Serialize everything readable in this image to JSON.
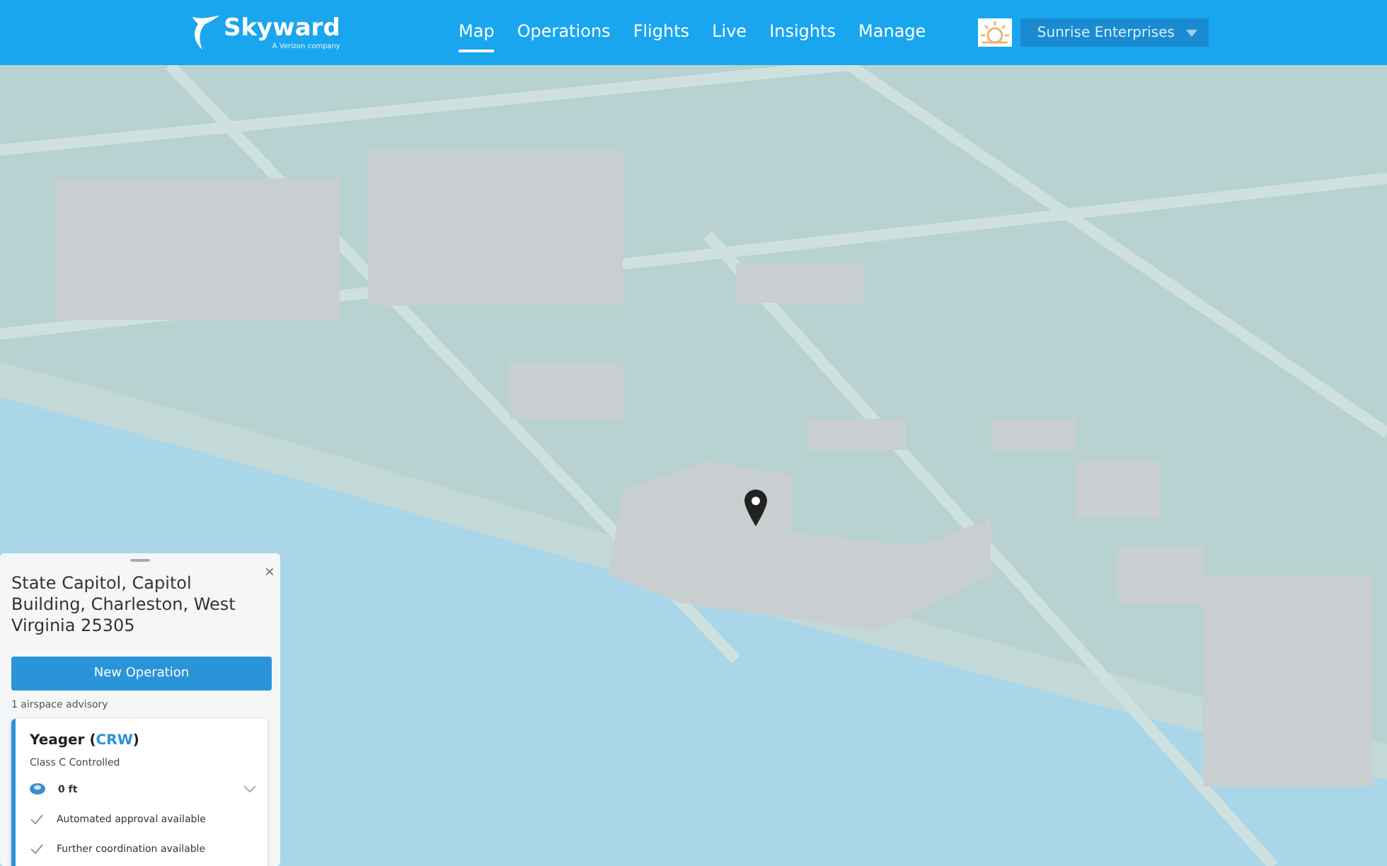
{
  "header": {
    "logo": {
      "name": "Skyward",
      "tagline": "A Verizon company"
    },
    "tabs": [
      {
        "label": "Map",
        "selected": true
      },
      {
        "label": "Operations",
        "selected": false
      },
      {
        "label": "Flights",
        "selected": false
      },
      {
        "label": "Live",
        "selected": false
      },
      {
        "label": "Insights",
        "selected": false
      },
      {
        "label": "Manage",
        "selected": false
      }
    ],
    "organization": {
      "name": "Sunrise Enterprises"
    }
  },
  "panel": {
    "address": "State Capitol, Capitol Building, Charleston, West Virginia 25305",
    "close": "×",
    "button": "New Operation",
    "advisory_count": "1 airspace advisory",
    "advisory": {
      "title_before": "Yeager (",
      "code": "CRW",
      "title_after": ")",
      "class": "Class C Controlled",
      "rows": [
        {
          "kind": "altitude",
          "text": "0 ft"
        },
        {
          "kind": "check",
          "text": "Automated approval available"
        },
        {
          "kind": "check",
          "text": "Further coordination available"
        }
      ]
    }
  }
}
